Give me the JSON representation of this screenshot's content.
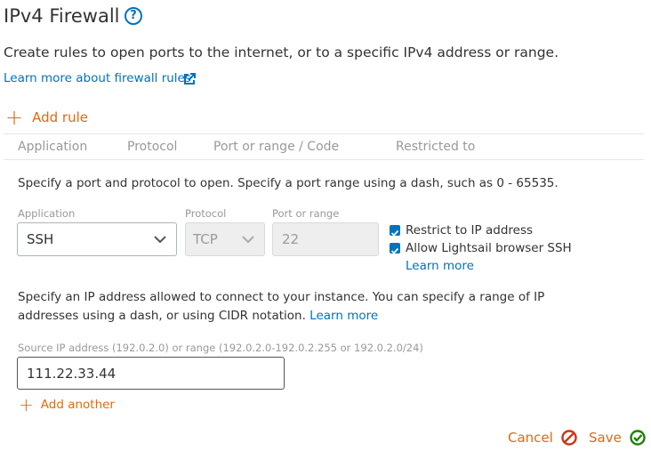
{
  "header": {
    "title": "IPv4 Firewall",
    "help_icon": "?",
    "description": "Create rules to open ports to the internet, or to a specific IPv4 address or range.",
    "learn_more_label": "Learn more about firewall rules"
  },
  "add_rule_label": "Add rule",
  "table_columns": [
    "Application",
    "Protocol",
    "Port or range / Code",
    "Restricted to"
  ],
  "rule_editor": {
    "instruction": "Specify a port and protocol to open. Specify a port range using a dash, such as 0 - 65535.",
    "application": {
      "label": "Application",
      "value": "SSH"
    },
    "protocol": {
      "label": "Protocol",
      "value": "TCP"
    },
    "port": {
      "label": "Port or range",
      "value": "22"
    },
    "restrict_ip": {
      "label": "Restrict to IP address",
      "checked": true
    },
    "allow_ssh": {
      "label": "Allow Lightsail browser SSH",
      "checked": true
    },
    "ssh_learn_more": "Learn more",
    "ip_instruction_line1": "Specify an IP address allowed to connect to your instance. You can specify a range of IP",
    "ip_instruction_line2": "addresses using a dash, or using CIDR notation.",
    "ip_learn_more": "Learn more",
    "source_label": "Source IP address (192.0.2.0) or range (192.0.2.0-192.0.2.255 or 192.0.2.0/24)",
    "source_value": "111.22.33.44",
    "add_another_label": "Add another"
  },
  "actions": {
    "cancel_label": "Cancel",
    "save_label": "Save"
  },
  "colors": {
    "accent_orange": "#dd6b10",
    "link_blue": "#0073bb",
    "save_green": "#1d8102",
    "cancel_red": "#d13212"
  }
}
